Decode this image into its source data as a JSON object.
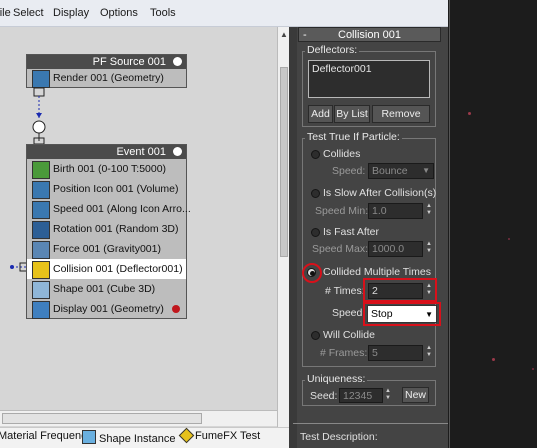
{
  "menubar": {
    "items": [
      "File",
      "Select",
      "Display",
      "Options",
      "Tools"
    ]
  },
  "nodes": {
    "pf_source": {
      "title": "PF Source 001",
      "rows": [
        {
          "label": "Render 001 (Geometry)",
          "icon": "render-icon"
        }
      ]
    },
    "event": {
      "title": "Event 001",
      "rows": [
        {
          "label": "Birth 001 (0-100 T:5000)",
          "icon": "birth-icon"
        },
        {
          "label": "Position Icon 001 (Volume)",
          "icon": "position-icon"
        },
        {
          "label": "Speed 001 (Along Icon Arro...",
          "icon": "speed-icon"
        },
        {
          "label": "Rotation 001 (Random 3D)",
          "icon": "rotation-icon"
        },
        {
          "label": "Force 001 (Gravity001)",
          "icon": "force-icon"
        },
        {
          "label": "Collision 001 (Deflector001)",
          "icon": "collision-icon",
          "selected": true
        },
        {
          "label": "Shape 001 (Cube 3D)",
          "icon": "shape-icon"
        },
        {
          "label": "Display 001 (Geometry)",
          "icon": "display-icon"
        }
      ]
    }
  },
  "rollout": {
    "collapse": "-",
    "title": "Collision 001",
    "deflectors": {
      "label": "Deflectors:",
      "list_item": "Deflector001",
      "buttons": [
        "Add",
        "By List",
        "Remove"
      ]
    },
    "test": {
      "label": "Test True If Particle:",
      "collides": "Collides",
      "speed_label": "Speed:",
      "speed_value": "Bounce",
      "slow": "Is Slow After Collision(s)",
      "speed_min_label": "Speed Min:",
      "speed_min_value": "1.0",
      "fast": "Is Fast After",
      "speed_max_label": "Speed Max:",
      "speed_max_value": "1000.0",
      "multiple": "Collided Multiple Times",
      "times_label": "# Times:",
      "times_value": "2",
      "speed2_label": "Speed:",
      "speed2_value": "Stop",
      "will": "Will Collide",
      "frames_label": "# Frames:",
      "frames_value": "5"
    },
    "uniqueness": {
      "label": "Uniqueness:",
      "seed_label": "Seed:",
      "seed_value": "12345",
      "new_label": "New"
    },
    "test_description": "Test Description:"
  },
  "statusbar": {
    "items": [
      "Material Frequency",
      "Shape Instance",
      "FumeFX Test"
    ]
  },
  "colors": {
    "highlight": "#d8101a",
    "panel": "#444444",
    "canvas": "#d6d6d6"
  }
}
